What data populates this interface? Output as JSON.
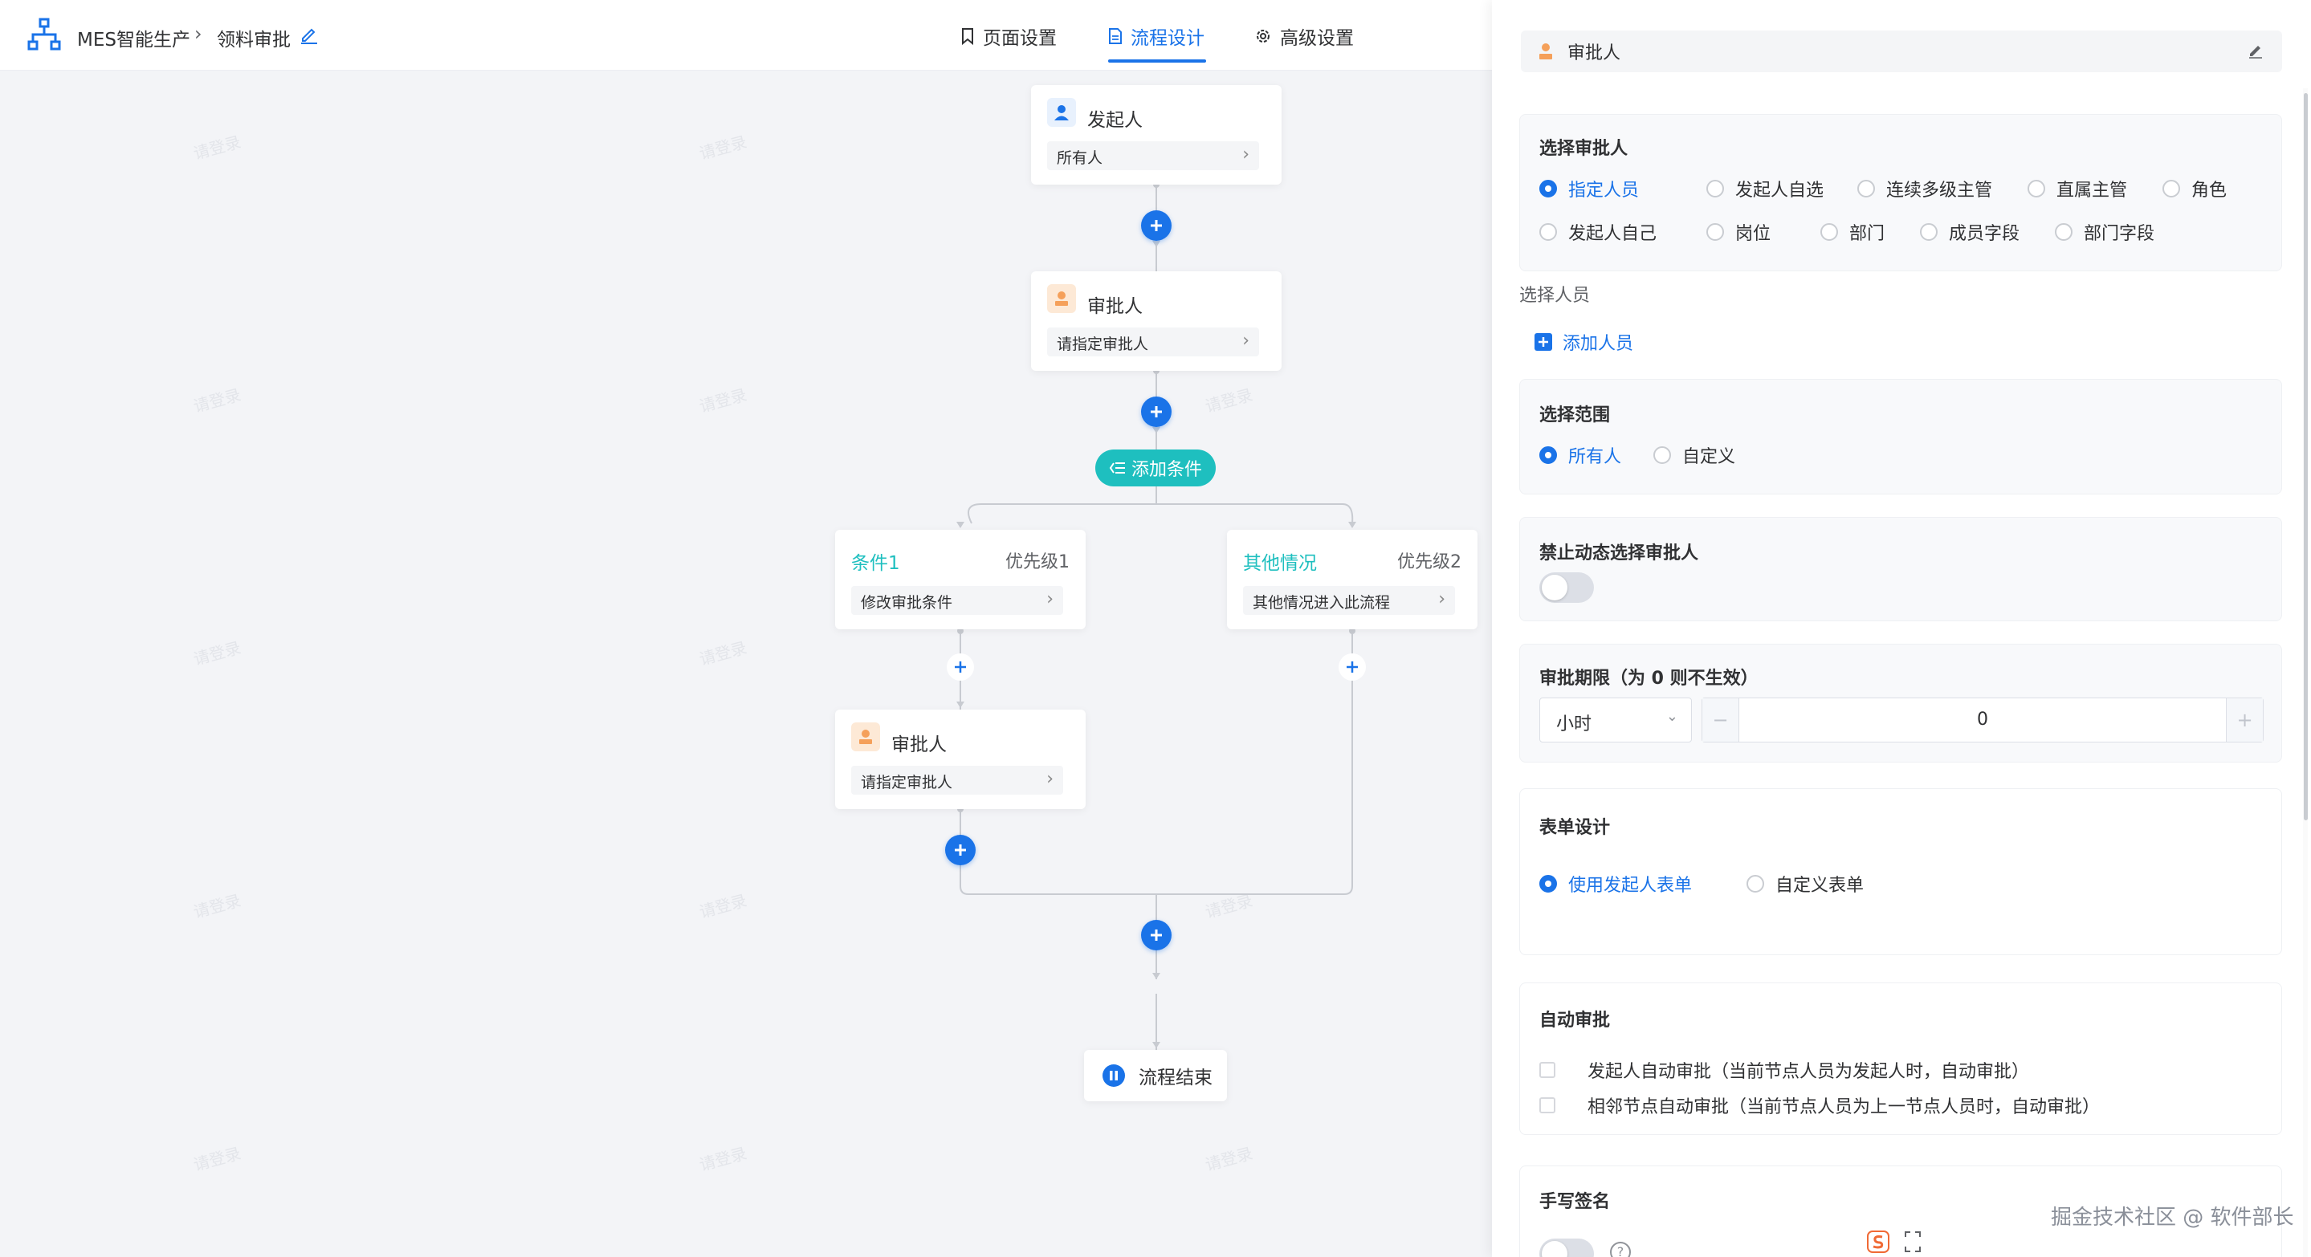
{
  "header": {
    "app_name": "MES智能生产",
    "breadcrumb_sep": ">",
    "form_name": "领料审批",
    "tabs": [
      {
        "label": "页面设置",
        "icon": "bookmark-icon"
      },
      {
        "label": "流程设计",
        "icon": "document-icon",
        "active": true
      },
      {
        "label": "高级设置",
        "icon": "gear-icon"
      }
    ]
  },
  "watermark_text": "请登录",
  "flow": {
    "start": {
      "title": "发起人",
      "body": "所有人"
    },
    "approver1": {
      "title": "审批人",
      "body": "请指定审批人"
    },
    "add_condition": "添加条件",
    "branches": [
      {
        "name": "条件1",
        "priority": "优先级1",
        "body": "修改审批条件"
      },
      {
        "name": "其他情况",
        "priority": "优先级2",
        "body": "其他情况进入此流程"
      }
    ],
    "approver2": {
      "title": "审批人",
      "body": "请指定审批人"
    },
    "end": "流程结束"
  },
  "panel": {
    "title": "审批人",
    "select_approver": {
      "title": "选择审批人",
      "options": [
        "指定人员",
        "发起人自选",
        "连续多级主管",
        "直属主管",
        "角色",
        "发起人自己",
        "岗位",
        "部门",
        "成员字段",
        "部门字段"
      ],
      "selected": "指定人员"
    },
    "select_person_label": "选择人员",
    "add_person": "添加人员",
    "scope": {
      "title": "选择范围",
      "options": [
        "所有人",
        "自定义"
      ],
      "selected": "所有人"
    },
    "disable_dynamic": {
      "title": "禁止动态选择审批人",
      "enabled": false
    },
    "deadline": {
      "title": "审批期限（为 0 则不生效）",
      "unit": "小时",
      "value": "0",
      "minus": "−",
      "plus": "+"
    },
    "form_design": {
      "title": "表单设计",
      "options": [
        "使用发起人表单",
        "自定义表单"
      ],
      "selected": "使用发起人表单"
    },
    "auto_approve": {
      "title": "自动审批",
      "options": [
        "发起人自动审批（当前节点人员为发起人时，自动审批）",
        "相邻节点自动审批（当前节点人员为上一节点人员时，自动审批）"
      ]
    },
    "signature": {
      "title": "手写签名",
      "help": "?"
    }
  },
  "footer_watermark": "掘金技术社区 @ 软件部长",
  "colors": {
    "primary": "#1a73e8",
    "teal": "#1ebfbf",
    "approver_orange": "#f5a05a"
  }
}
